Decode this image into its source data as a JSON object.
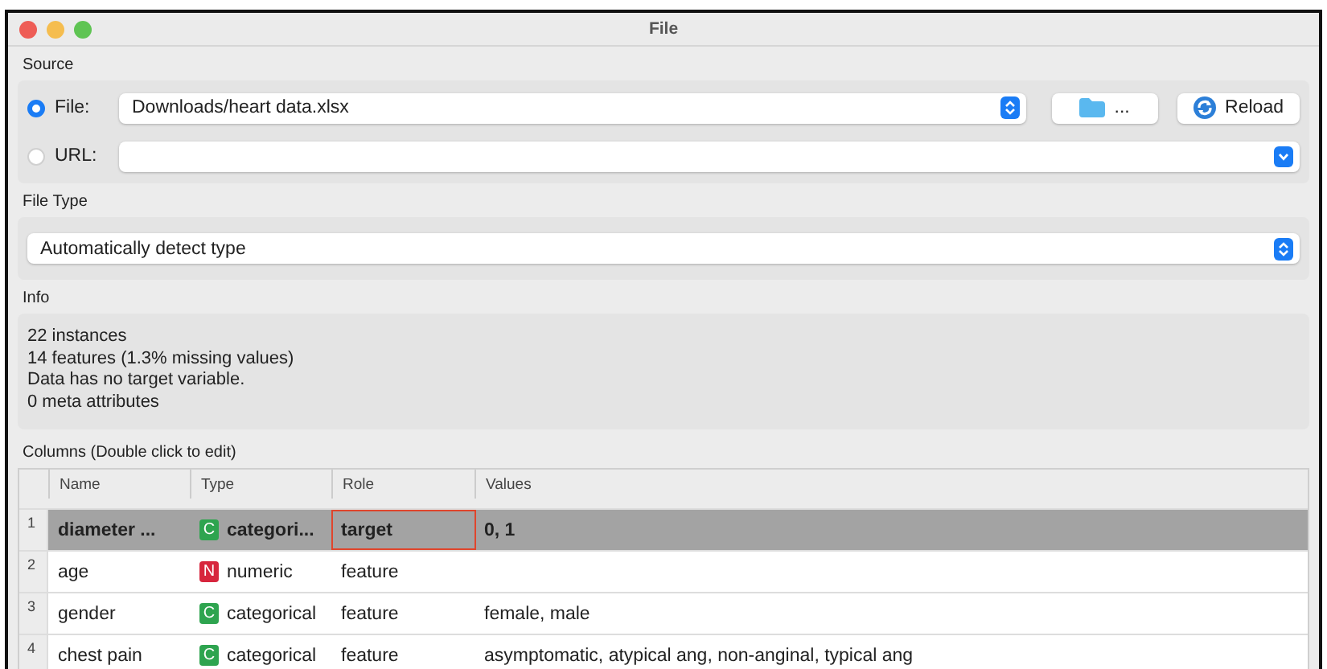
{
  "window": {
    "title": "File"
  },
  "source": {
    "label": "Source",
    "options": [
      {
        "label": "File:",
        "selected": true,
        "value": "Downloads/heart data.xlsx",
        "kind": "stepper"
      },
      {
        "label": "URL:",
        "selected": false,
        "kind": "dropdown"
      }
    ],
    "browse_button": "...",
    "reload_button": "Reload"
  },
  "file_type": {
    "label": "File Type",
    "value": "Automatically detect type"
  },
  "info": {
    "label": "Info",
    "lines": [
      "22 instances",
      "14 features (1.3% missing values)",
      "Data has no target variable.",
      "0 meta attributes"
    ]
  },
  "columns": {
    "label": "Columns (Double click to edit)",
    "headers": [
      "Name",
      "Type",
      "Role",
      "Values"
    ],
    "rows": [
      {
        "number": "1",
        "name": "diameter ...",
        "badge": "C",
        "color": "#2ea44f",
        "type": "categori...",
        "role": "target",
        "values": "0, 1",
        "selected": true,
        "role_highlighted": true
      },
      {
        "number": "2",
        "name": "age",
        "badge": "N",
        "color": "#d7263d",
        "type": "numeric",
        "role": "feature",
        "selected": false,
        "role_highlighted": false
      },
      {
        "number": "3",
        "name": "gender",
        "badge": "C",
        "color": "#2ea44f",
        "type": "categorical",
        "role": "feature",
        "values": "female, male",
        "selected": false,
        "role_highlighted": false
      },
      {
        "number": "4",
        "name": "chest pain",
        "badge": "C",
        "color": "#2ea44f",
        "type": "categorical",
        "role": "feature",
        "values": "asymptomatic, atypical ang, non-anginal, typical ang",
        "selected": false,
        "role_highlighted": false
      }
    ]
  }
}
